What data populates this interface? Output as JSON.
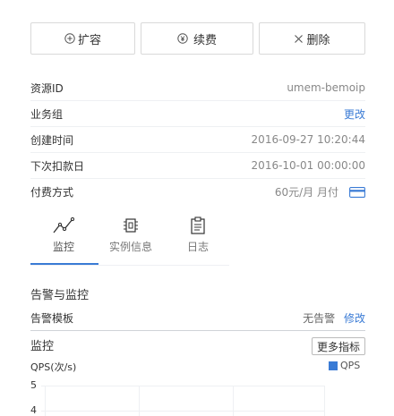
{
  "toolbar": {
    "expand_label": "扩容",
    "renew_label": "续费",
    "delete_label": "删除"
  },
  "details": {
    "resource_id_label": "资源ID",
    "resource_id_value": "umem-bemoip",
    "business_group_label": "业务组",
    "business_group_action": "更改",
    "created_label": "创建时间",
    "created_value": "2016-09-27 10:20:44",
    "next_charge_label": "下次扣款日",
    "next_charge_value": "2016-10-01 00:00:00",
    "payment_label": "付费方式",
    "payment_value": "60元/月 月付"
  },
  "tabs": [
    {
      "label": "监控",
      "icon": "line-chart-icon",
      "active": true
    },
    {
      "label": "实例信息",
      "icon": "chip-icon",
      "active": false
    },
    {
      "label": "日志",
      "icon": "clipboard-icon",
      "active": false
    }
  ],
  "alert_section": {
    "title": "告警与监控",
    "template_label": "告警模板",
    "template_value": "无告警",
    "template_action": "修改"
  },
  "monitor_section": {
    "title": "监控",
    "more_metrics_label": "更多指标"
  },
  "chart_data": {
    "type": "line",
    "ylabel": "QPS(次/s)",
    "legend": [
      "QPS"
    ],
    "series": [
      {
        "name": "QPS",
        "values": []
      }
    ],
    "y_ticks": [
      "5",
      "4"
    ],
    "legend_placement": "top-right",
    "colors": {
      "QPS": "#3a7bd5"
    }
  },
  "colors": {
    "accent": "#3a7bd5",
    "border": "#d9d9d9"
  }
}
